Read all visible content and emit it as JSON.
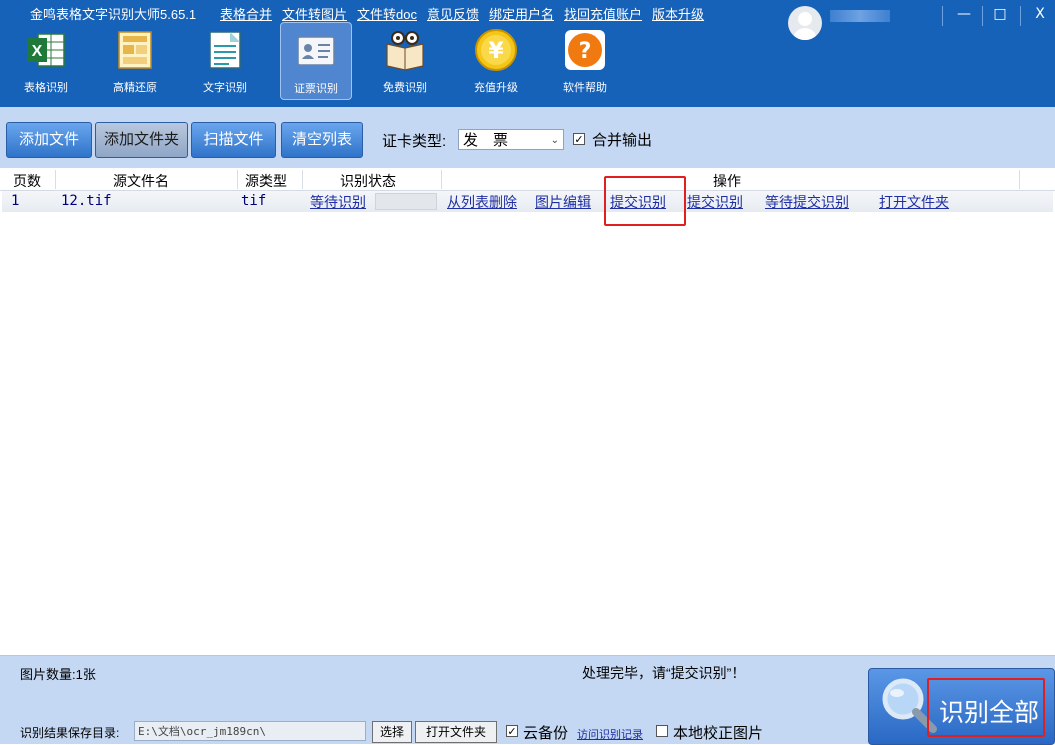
{
  "app": {
    "title": "金鸣表格文字识别大师5.65.1",
    "top_menu": [
      "表格合并",
      "文件转图片",
      "文件转doc",
      "意见反馈",
      "绑定用户名",
      "找回充值账户",
      "版本升级"
    ],
    "window_controls": [
      "—",
      "□",
      "X"
    ]
  },
  "tools": [
    {
      "label": "表格识别",
      "icon": "excel-icon"
    },
    {
      "label": "高精还原",
      "icon": "layout-icon"
    },
    {
      "label": "文字识别",
      "icon": "document-icon"
    },
    {
      "label": "证票识别",
      "icon": "id-card-icon",
      "active": true
    },
    {
      "label": "免费识别",
      "icon": "book-glasses-icon"
    },
    {
      "label": "充值升级",
      "icon": "yen-coin-icon"
    },
    {
      "label": "软件帮助",
      "icon": "help-icon"
    }
  ],
  "toolbar": {
    "buttons": [
      "添加文件",
      "添加文件夹",
      "扫描文件",
      "清空列表"
    ],
    "card_type_label": "证卡类型:",
    "card_type_value": "发　票",
    "merge_output_label": "合并输出",
    "merge_output_checked": true
  },
  "table": {
    "headers": [
      "页数",
      "源文件名",
      "源类型",
      "识别状态",
      "操作"
    ],
    "rows": [
      {
        "page": "1",
        "filename": "12.tif",
        "type": "tif",
        "status": "等待识别",
        "actions": [
          "从列表删除",
          "图片编辑",
          "提交识别",
          "提交识别",
          "等待提交识别",
          "打开文件夹"
        ]
      }
    ]
  },
  "bottom": {
    "image_count": "图片数量:1张",
    "message": "处理完毕，请“提交识别”！",
    "save_dir_label": "识别结果保存目录:",
    "save_dir_value": "E:\\文档\\ocr_jm189cn\\",
    "choose_label": "选择",
    "open_folder_label": "打开文件夹",
    "cloud_backup_label": "云备份",
    "cloud_backup_checked": true,
    "visit_record_label": "访问识别记录",
    "local_correct_label": "本地校正图片",
    "local_correct_checked": false,
    "recognize_all_label": "识别全部"
  },
  "colors": {
    "title_bar": "#1762b9",
    "panel": "#c5d8f3",
    "highlight": "#e02020",
    "link": "#1f2fa3"
  }
}
